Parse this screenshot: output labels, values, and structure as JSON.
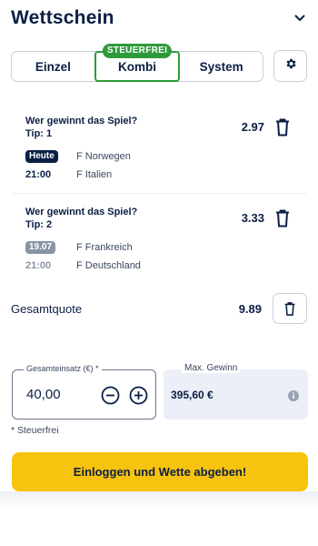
{
  "header": {
    "title": "Wettschein",
    "toggle_icon": "chevron-down-icon"
  },
  "tabs": [
    {
      "label": "Einzel",
      "active": false
    },
    {
      "label": "Kombi",
      "active": true,
      "badge": "STEUERFREI"
    },
    {
      "label": "System",
      "active": false
    }
  ],
  "settings": {
    "icon": "gear-icon"
  },
  "bets": [
    {
      "question": "Wer gewinnt das Spiel?",
      "tip": "Tip: 1",
      "odds": "2.97",
      "matches": [
        {
          "date_badge": "Heute",
          "team": "F Norwegen"
        },
        {
          "time": "21:00",
          "team": "F Italien"
        }
      ]
    },
    {
      "question": "Wer gewinnt das Spiel?",
      "tip": "Tip: 2",
      "odds": "3.33",
      "matches": [
        {
          "date_badge": "19.07",
          "team": "F Frankreich"
        },
        {
          "time": "21:00",
          "team": "F Deutschland"
        }
      ]
    }
  ],
  "total": {
    "label": "Gesamtquote",
    "odds": "9.89"
  },
  "stake": {
    "label": "Gesamteinsatz (€) *",
    "value": "40,00"
  },
  "max_win": {
    "label": "Max. Gewinn",
    "value": "395,60 €"
  },
  "footnote": "* Steuerfrei",
  "cta": {
    "label": "Einloggen und Wette abgeben!"
  },
  "colors": {
    "accent_green": "#2e9b3a",
    "cta_yellow": "#f7c30f",
    "navy": "#0b1f44"
  }
}
